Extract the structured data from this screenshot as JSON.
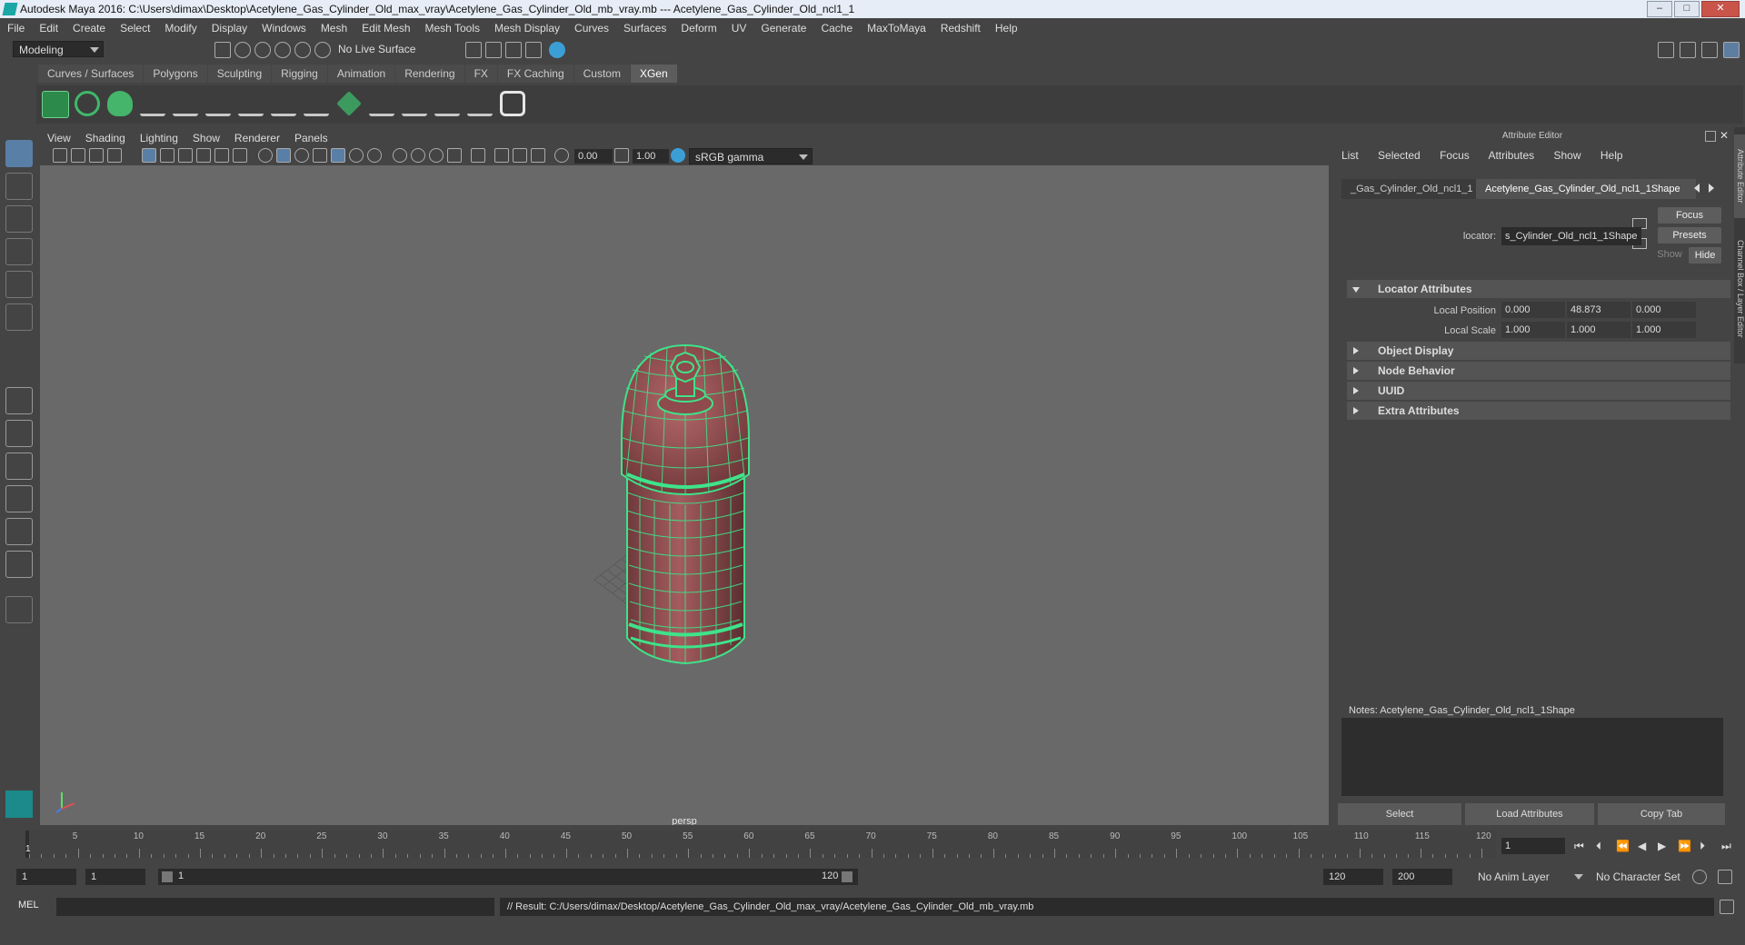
{
  "window": {
    "title": "Autodesk Maya 2016: C:\\Users\\dimax\\Desktop\\Acetylene_Gas_Cylinder_Old_max_vray\\Acetylene_Gas_Cylinder_Old_mb_vray.mb   ---   Acetylene_Gas_Cylinder_Old_ncl1_1",
    "buttons": {
      "minimize": "–",
      "maximize": "□",
      "close": "✕"
    }
  },
  "menubar": [
    "File",
    "Edit",
    "Create",
    "Select",
    "Modify",
    "Display",
    "Windows",
    "Mesh",
    "Edit Mesh",
    "Mesh Tools",
    "Mesh Display",
    "Curves",
    "Surfaces",
    "Deform",
    "UV",
    "Generate",
    "Cache",
    "MaxToMaya",
    "Redshift",
    "Help"
  ],
  "statusline": {
    "mode": "Modeling",
    "live_surface": "No Live Surface"
  },
  "shelf": {
    "tabs": [
      "Curves / Surfaces",
      "Polygons",
      "Sculpting",
      "Rigging",
      "Animation",
      "Rendering",
      "FX",
      "FX Caching",
      "Custom",
      "XGen"
    ],
    "active_tab": "XGen"
  },
  "viewport": {
    "menu": [
      "View",
      "Shading",
      "Lighting",
      "Show",
      "Renderer",
      "Panels"
    ],
    "exposure": "0.00",
    "gamma": "1.00",
    "color_space": "sRGB gamma",
    "camera_label": "persp"
  },
  "attribute_editor": {
    "title": "Attribute Editor",
    "menu": [
      "List",
      "Selected",
      "Focus",
      "Attributes",
      "Show",
      "Help"
    ],
    "tabs": [
      "_Gas_Cylinder_Old_ncl1_1",
      "Acetylene_Gas_Cylinder_Old_ncl1_1Shape"
    ],
    "focus_button": "Focus",
    "presets_button": "Presets",
    "show_button": "Show",
    "hide_button": "Hide",
    "locator_label": "locator:",
    "locator_value": "s_Cylinder_Old_ncl1_1Shape",
    "sections": {
      "locator": {
        "label": "Locator Attributes",
        "local_position_label": "Local Position",
        "local_position": [
          "0.000",
          "48.873",
          "0.000"
        ],
        "local_scale_label": "Local Scale",
        "local_scale": [
          "1.000",
          "1.000",
          "1.000"
        ]
      },
      "collapsed": [
        "Object Display",
        "Node Behavior",
        "UUID",
        "Extra Attributes"
      ]
    },
    "notes_label": "Notes:  Acetylene_Gas_Cylinder_Old_ncl1_1Shape",
    "bottom_buttons": [
      "Select",
      "Load Attributes",
      "Copy Tab"
    ],
    "side_tabs": [
      "Attribute Editor",
      "Channel Box / Layer Editor"
    ]
  },
  "timeline": {
    "ticks": [
      "5",
      "10",
      "15",
      "20",
      "25",
      "30",
      "35",
      "40",
      "45",
      "50",
      "55",
      "60",
      "65",
      "70",
      "75",
      "80",
      "85",
      "90",
      "95",
      "100",
      "105",
      "110",
      "115",
      "120"
    ],
    "current_frame_marker": "1",
    "current_frame_field": "1"
  },
  "range": {
    "start": "1",
    "playback_start": "1",
    "slider_start": "1",
    "slider_end": "120",
    "playback_end": "120",
    "end": "200",
    "anim_layer": "No Anim Layer",
    "character_set": "No Character Set"
  },
  "command": {
    "language": "MEL",
    "result": "// Result: C:/Users/dimax/Desktop/Acetylene_Gas_Cylinder_Old_max_vray/Acetylene_Gas_Cylinder_Old_mb_vray.mb"
  },
  "colors": {
    "wireframe": "#3ee38a",
    "cylinder_body": "#8e4a4c",
    "viewport_bg": "#696969",
    "active_tab": "#5d5d5d"
  }
}
